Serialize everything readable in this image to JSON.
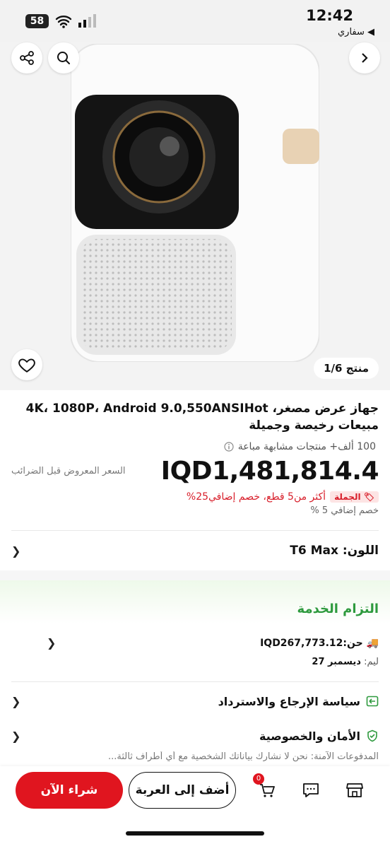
{
  "status": {
    "time": "12:42",
    "back_app": "◀ سفاري",
    "battery": "58"
  },
  "gallery": {
    "counter": "منتج 1/6"
  },
  "product": {
    "title": "جهاز عرض مصغر، 4K، 1080P، Android 9.0,550ANSIHot مبيعات رخيصة وجميلة",
    "sold": "100 ألف+ منتجات مشابهة مباعة",
    "price": "IQD1,481,814.4",
    "pre_tax": "السعر المعروض قبل الضرائب",
    "promo_tag": "الجملة",
    "promo_text": "أكثر من5 قطع، خصم إضافي25%",
    "extra_discount": "خصم إضافي 5 %"
  },
  "color": {
    "label": "اللون:",
    "value": "T6 Max"
  },
  "service": {
    "heading": "التزام الخدمة",
    "ship_label": "حن:",
    "ship_amount": "IQD267,773.12",
    "delivery_prefix": "ليم:",
    "delivery_date": "ديسمبر 27",
    "return_policy": "سياسة الإرجاع والاسترداد",
    "security": "الأمان والخصوصية",
    "security_text": "المدفوعات الآمنة: نحن لا نشارك بياناتك الشخصية مع أي أطراف ثالثة..."
  },
  "bottom": {
    "buy_now": "شراء الآن",
    "add_to_cart": "أضف إلى العربة",
    "cart_count": "0"
  }
}
